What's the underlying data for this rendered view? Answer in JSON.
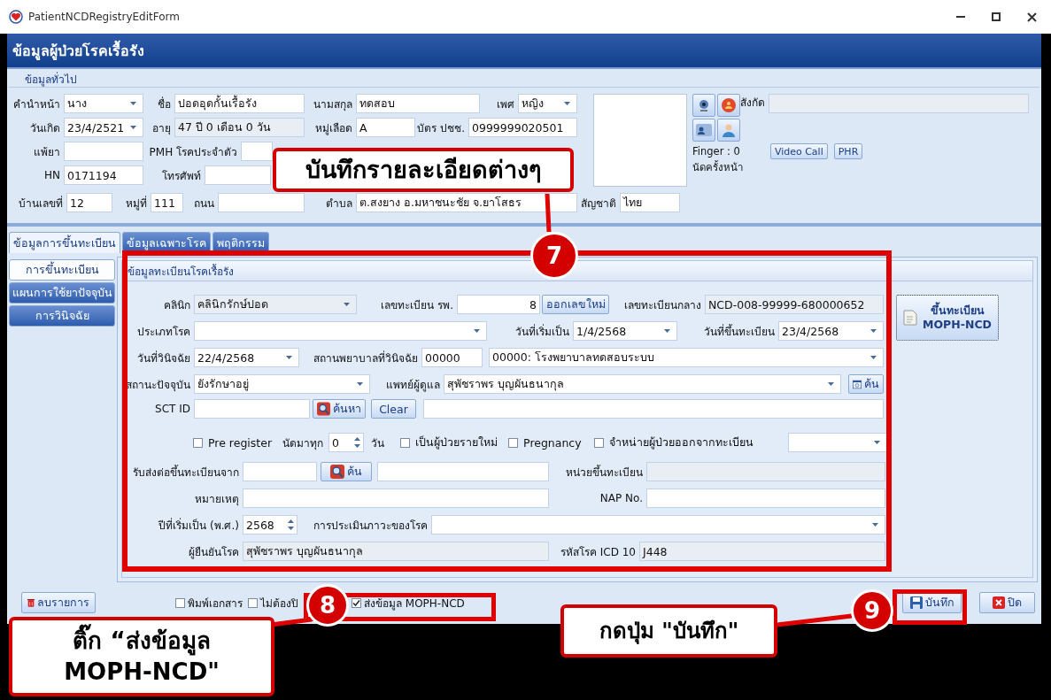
{
  "window": {
    "title": "PatientNCDRegistryEditForm"
  },
  "header": {
    "title": "ข้อมูลผู้ป่วยโรคเรื้อรัง"
  },
  "general": {
    "title": "ข้อมูลทั่วไป",
    "rows": [
      {
        "fields": [
          {
            "kind": "label",
            "text": "คำนำหน้า"
          },
          {
            "kind": "combo",
            "value": "นาง"
          },
          {
            "kind": "label",
            "text": "ชื่อ"
          },
          {
            "kind": "text",
            "value": "ปอดอุดกั้นเรื้อรัง"
          },
          {
            "kind": "label",
            "text": "นามสกุล"
          },
          {
            "kind": "text",
            "value": "ทดสอบ"
          },
          {
            "kind": "label",
            "text": "เพศ"
          },
          {
            "kind": "combo",
            "value": "หญิง"
          }
        ]
      },
      {
        "fields": [
          {
            "kind": "label",
            "text": "วันเกิด"
          },
          {
            "kind": "combo",
            "value": "23/4/2521"
          },
          {
            "kind": "label",
            "text": "อายุ"
          },
          {
            "kind": "readonly",
            "value": "47 ปี 0 เดือน 0 วัน"
          },
          {
            "kind": "label",
            "text": "หมู่เลือด"
          },
          {
            "kind": "text",
            "value": "A"
          },
          {
            "kind": "label",
            "text": "บัตร ปชช."
          },
          {
            "kind": "text",
            "value": "0999999020501"
          }
        ]
      },
      {
        "fields": [
          {
            "kind": "label",
            "text": "แพ้ยา"
          },
          {
            "kind": "text"
          },
          {
            "kind": "label",
            "text": "PMH โรคประจำตัว"
          },
          {
            "kind": "text"
          }
        ]
      },
      {
        "fields": [
          {
            "kind": "label",
            "text": "HN"
          },
          {
            "kind": "text",
            "value": "0171194"
          },
          {
            "kind": "label",
            "text": "โทรศัพท์"
          },
          {
            "kind": "text"
          }
        ]
      },
      {
        "fields": [
          {
            "kind": "label",
            "text": "บ้านเลขที่"
          },
          {
            "kind": "text",
            "value": "12"
          },
          {
            "kind": "label",
            "text": "หมู่ที่"
          },
          {
            "kind": "text",
            "value": "111"
          },
          {
            "kind": "label",
            "text": "ถนน"
          },
          {
            "kind": "text"
          },
          {
            "kind": "label",
            "text": "ตำบล"
          },
          {
            "kind": "text",
            "value": "ต.สงยาง อ.มหาชนะชัย จ.ยาโสธร"
          },
          {
            "kind": "label",
            "text": "สัญชาติ"
          },
          {
            "kind": "text",
            "value": "ไทย"
          }
        ]
      }
    ],
    "affiliation_label": "สังกัด",
    "finger": "Finger : 0",
    "next_appointment": "นัดครั้งหน้า",
    "buttons": [
      "Video Call",
      "PHR"
    ]
  },
  "tabs": [
    {
      "label": "ข้อมูลการขึ้นทะเบียน",
      "selected": true
    },
    {
      "label": "ข้อมูลเฉพาะโรค",
      "selected": false
    },
    {
      "label": "พฤติกรรม",
      "selected": false
    }
  ],
  "nav": [
    {
      "label": "การขึ้นทะเบียน",
      "selected": true
    },
    {
      "label": "แผนการใช้ยาปัจจุบัน",
      "selected": false
    },
    {
      "label": "การวินิจฉัย",
      "selected": false
    }
  ],
  "registry": {
    "title": "ข้อมูลทะเบียนโรคเรื้อรัง",
    "register_button": "ขึ้นทะเบียน MOPH-NCD",
    "rows": [
      {
        "fields": [
          {
            "kind": "label",
            "text": "คลินิก"
          },
          {
            "kind": "readonly_combo",
            "value": "คลินิกรักษ์ปอด"
          },
          {
            "kind": "label",
            "text": "เลขทะเบียน รพ."
          },
          {
            "kind": "number",
            "value": "8"
          },
          {
            "kind": "button",
            "label": "ออกเลขใหม่"
          },
          {
            "kind": "label",
            "text": "เลขทะเบียนกลาง"
          },
          {
            "kind": "readonly",
            "value": "NCD-008-99999-680000652"
          }
        ]
      },
      {
        "fields": [
          {
            "kind": "label",
            "text": "ประเภทโรค"
          },
          {
            "kind": "combo"
          },
          {
            "kind": "label",
            "text": "วันที่เริ่มเป็น"
          },
          {
            "kind": "combo",
            "value": "1/4/2568"
          },
          {
            "kind": "label",
            "text": "วันที่ขึ้นทะเบียน"
          },
          {
            "kind": "combo",
            "value": "23/4/2568"
          }
        ]
      },
      {
        "fields": [
          {
            "kind": "label",
            "text": "วันที่วินิจฉัย"
          },
          {
            "kind": "combo",
            "value": "22/4/2568"
          },
          {
            "kind": "label",
            "text": "สถานพยาบาลที่วินิจฉัย"
          },
          {
            "kind": "text",
            "value": "00000"
          },
          {
            "kind": "combo",
            "value": "00000: โรงพยาบาลทดสอบระบบ"
          }
        ]
      },
      {
        "fields": [
          {
            "kind": "label",
            "text": "สถานะปัจจุบัน"
          },
          {
            "kind": "combo",
            "value": "ยังรักษาอยู่"
          },
          {
            "kind": "label",
            "text": "แพทย์ผู้ดูแล"
          },
          {
            "kind": "combo",
            "value": "สุพัชราพร บุญผันธนากุล"
          },
          {
            "kind": "lookup_button",
            "label": "ค้น"
          }
        ]
      },
      {
        "fields": [
          {
            "kind": "label",
            "text": "SCT ID"
          },
          {
            "kind": "text"
          },
          {
            "kind": "search_button",
            "label": "ค้นหา"
          },
          {
            "kind": "button",
            "label": "Clear"
          },
          {
            "kind": "text"
          }
        ]
      },
      {
        "fields": [
          {
            "kind": "check",
            "label": "Pre register",
            "checked": false
          },
          {
            "kind": "label",
            "text": "นัดมาทุก"
          },
          {
            "kind": "spin",
            "value": "0"
          },
          {
            "kind": "label",
            "text": "วัน"
          },
          {
            "kind": "check",
            "label": "เป็นผู้ป่วยรายใหม่",
            "checked": false
          },
          {
            "kind": "check",
            "label": "Pregnancy",
            "checked": false
          },
          {
            "kind": "check",
            "label": "จำหน่ายผู้ป่วยออกจากทะเบียน",
            "checked": false
          },
          {
            "kind": "combo"
          }
        ]
      },
      {
        "fields": [
          {
            "kind": "label",
            "text": "รับส่งต่อขึ้นทะเบียนจาก"
          },
          {
            "kind": "text"
          },
          {
            "kind": "search_button",
            "label": "ค้น"
          },
          {
            "kind": "text"
          },
          {
            "kind": "label",
            "text": "หน่วยขึ้นทะเบียน"
          },
          {
            "kind": "readonly"
          }
        ]
      },
      {
        "fields": [
          {
            "kind": "label",
            "text": "หมายเหตุ"
          },
          {
            "kind": "text"
          },
          {
            "kind": "label",
            "text": "NAP No."
          },
          {
            "kind": "text"
          }
        ]
      },
      {
        "fields": [
          {
            "kind": "label",
            "text": "ปีที่เริ่มเป็น (พ.ศ.)"
          },
          {
            "kind": "spin",
            "value": "2568"
          },
          {
            "kind": "label",
            "text": "การประเมินภาวะของโรค"
          },
          {
            "kind": "combo"
          }
        ]
      },
      {
        "fields": [
          {
            "kind": "label",
            "text": "ผู้ยืนยันโรค"
          },
          {
            "kind": "readonly",
            "value": "สุพัชราพร บุญผันธนากุล"
          },
          {
            "kind": "label",
            "text": "รหัสโรค ICD 10"
          },
          {
            "kind": "readonly",
            "value": "J448"
          }
        ]
      }
    ]
  },
  "footer": [
    {
      "kind": "delete_button",
      "label": "ลบรายการ"
    },
    {
      "kind": "check",
      "label": "พิมพ์เอกสาร",
      "checked": false
    },
    {
      "kind": "check",
      "label": "ไม่ต้องปิ",
      "checked": false
    },
    {
      "kind": "check",
      "label": "ส่งข้อมูล MOPH-NCD",
      "checked": true
    },
    {
      "kind": "save_button",
      "label": "บันทึก"
    },
    {
      "kind": "close_button",
      "label": "ปิด"
    }
  ],
  "annotations": [
    {
      "number": "7",
      "text": "บันทึกรายละเอียดต่างๆ"
    },
    {
      "number": "8",
      "text": "ติ๊ก “ส่งข้อมูล MOPH-NCD\""
    },
    {
      "number": "9",
      "text": "กดปุ่ม \"บันทึก\""
    }
  ]
}
